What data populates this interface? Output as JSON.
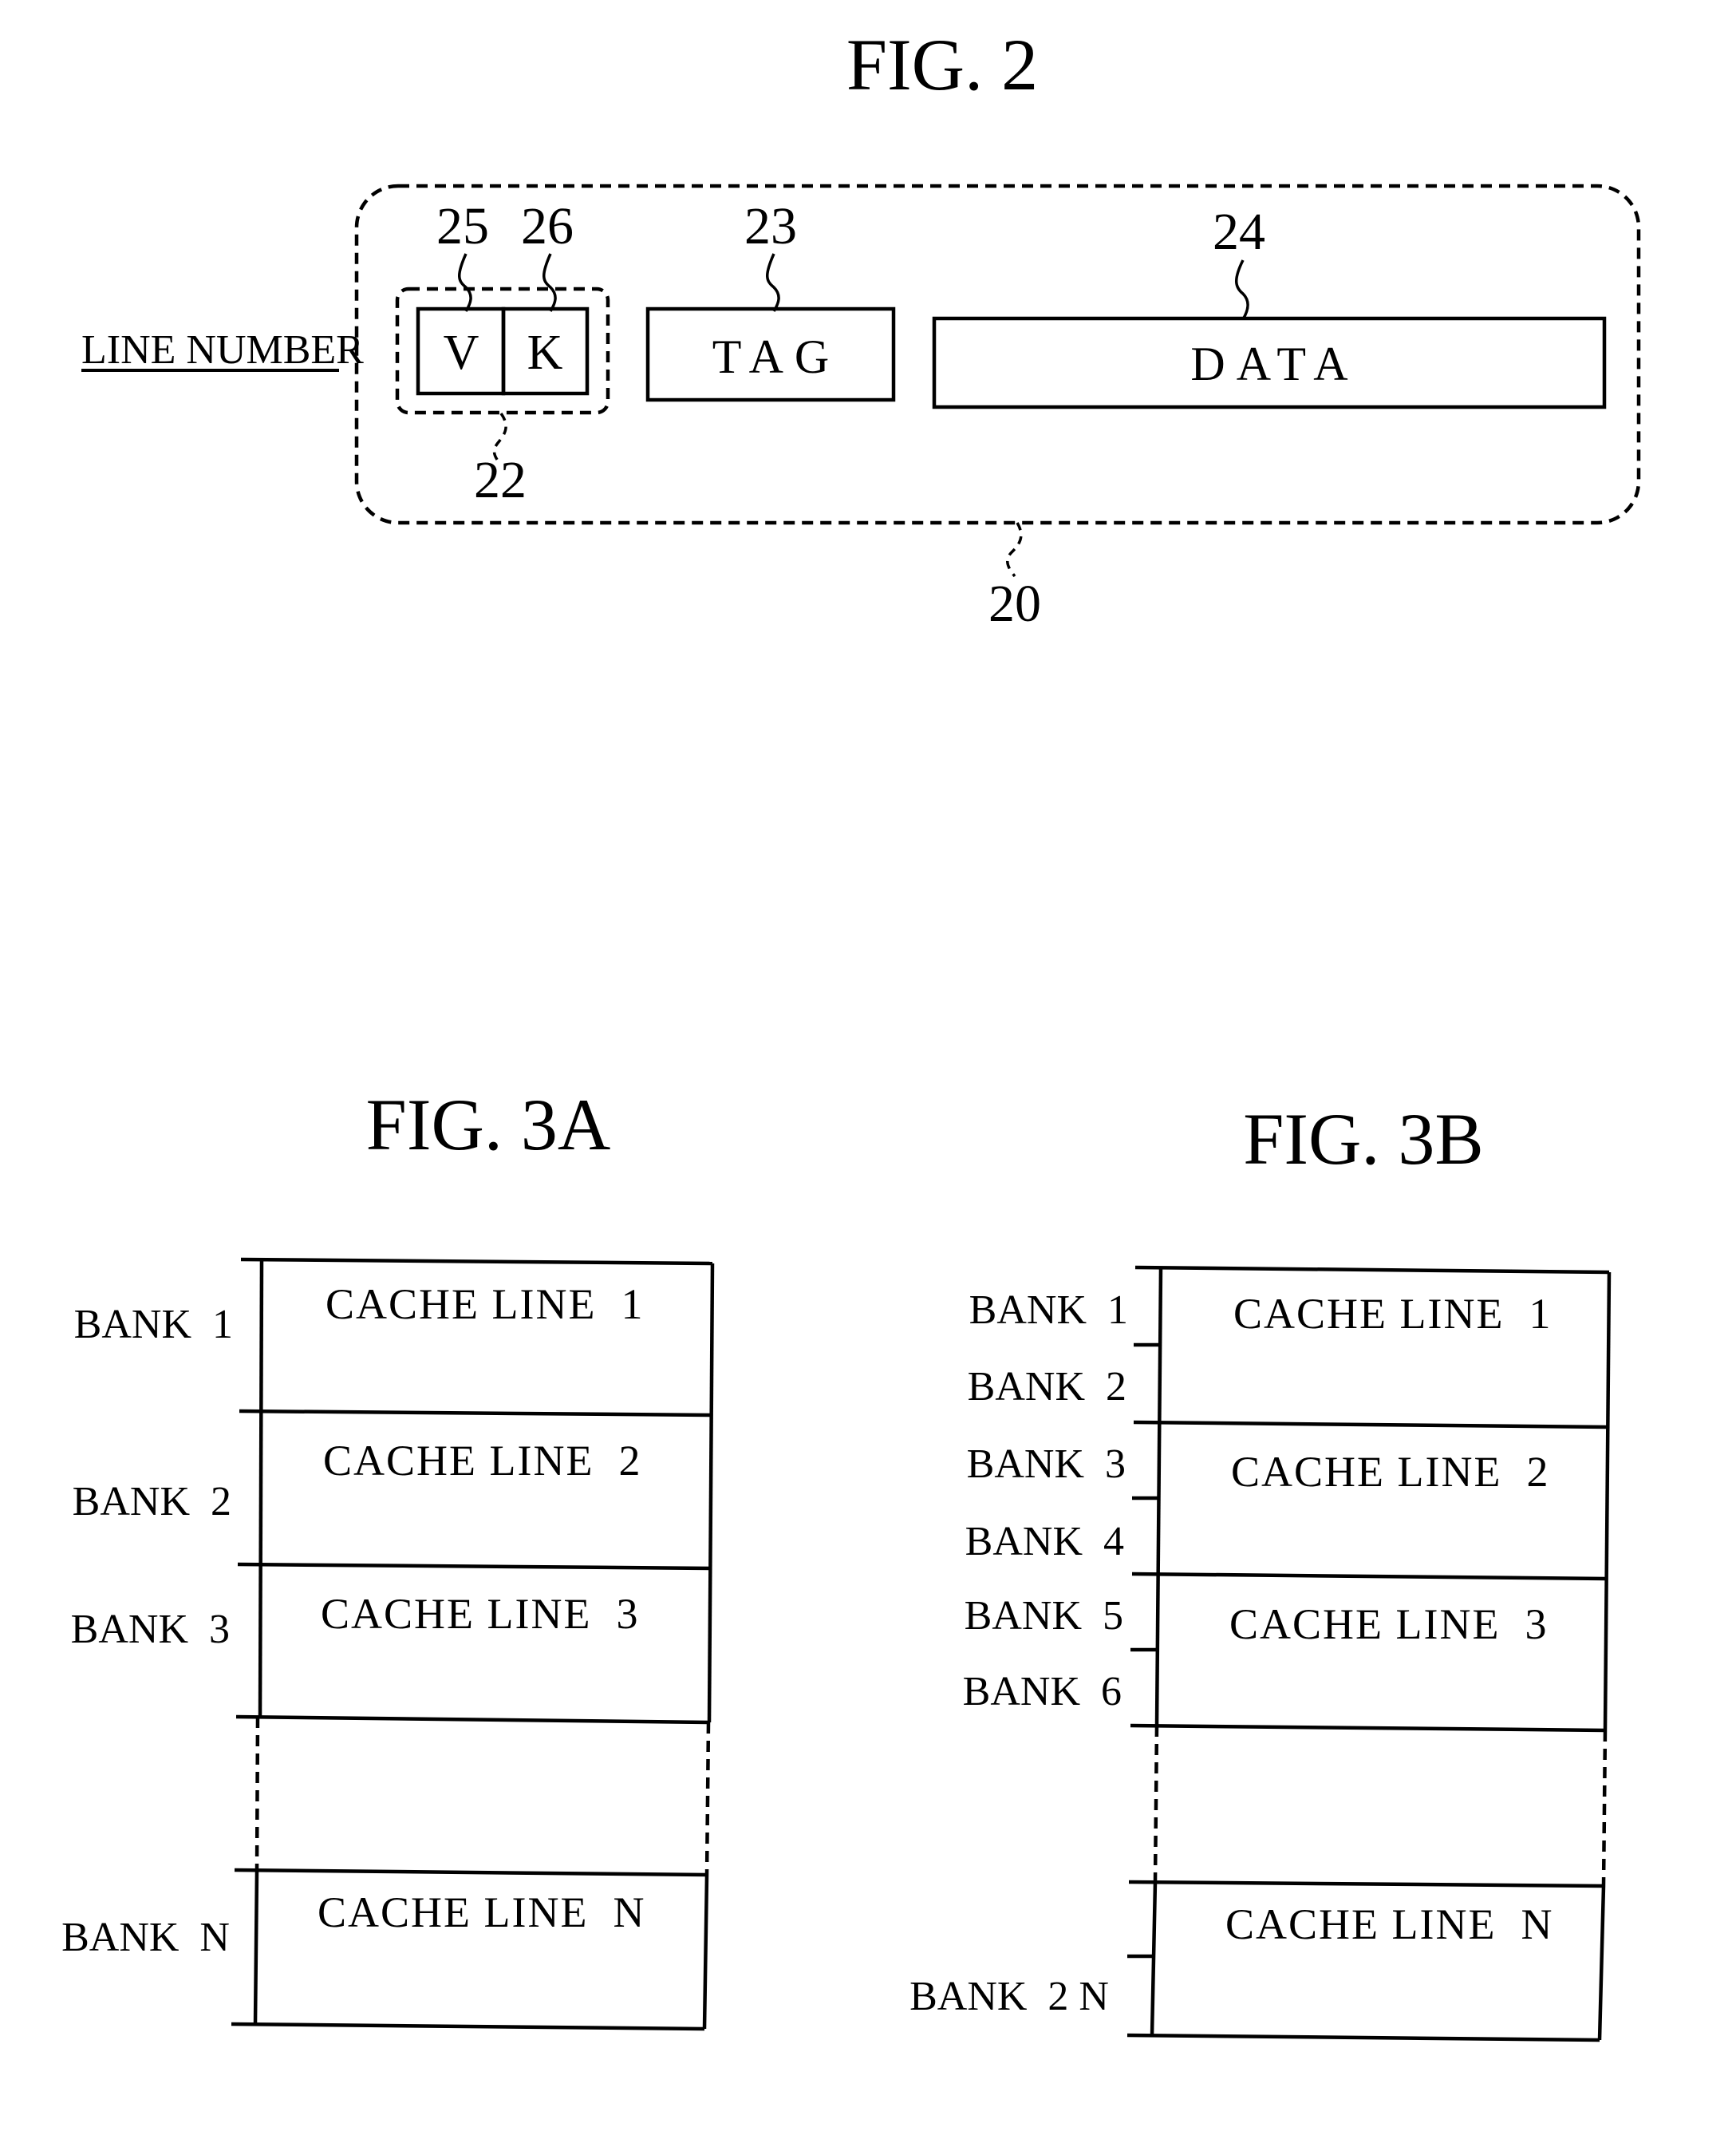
{
  "fig2": {
    "title": "FIG. 2",
    "line_number_label": "LINE NUMBER",
    "fields": {
      "v": "V",
      "k": "K",
      "tag": "TAG",
      "data": "DATA"
    },
    "callouts": {
      "valid_bit": "25",
      "k_bit": "26",
      "tag": "23",
      "data": "24",
      "flag_group": "22",
      "cache_line_entry": "20"
    }
  },
  "fig3a": {
    "title": "FIG. 3A",
    "banks": [
      "BANK  1",
      "BANK  2",
      "BANK  3",
      "BANK  N"
    ],
    "cache_lines": [
      "CACHE LINE  1",
      "CACHE LINE  2",
      "CACHE LINE  3",
      "CACHE LINE  N"
    ]
  },
  "fig3b": {
    "title": "FIG. 3B",
    "banks": [
      "BANK  1",
      "BANK  2",
      "BANK  3",
      "BANK  4",
      "BANK  5",
      "BANK  6",
      "BANK  2 N"
    ],
    "cache_lines": [
      "CACHE LINE  1",
      "CACHE LINE  2",
      "CACHE LINE  3",
      "CACHE LINE  N"
    ]
  }
}
